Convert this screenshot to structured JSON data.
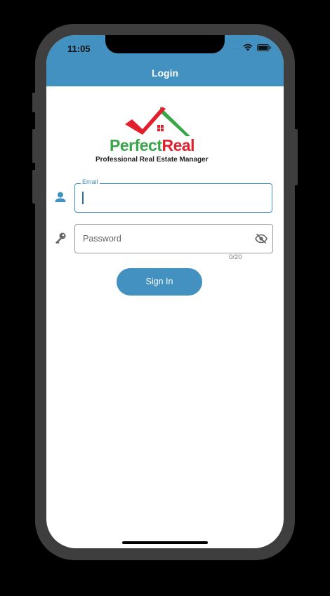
{
  "status_bar": {
    "time": "11:05",
    "signal": "....",
    "icons": [
      "wifi-icon",
      "battery-icon"
    ]
  },
  "nav": {
    "title": "Login",
    "color": "#4391c1"
  },
  "logo": {
    "word_1": "Perfect",
    "word_2": "Real",
    "tagline": "Professional Real Estate Manager",
    "colors": {
      "perfect": "#3aa64a",
      "real": "#e21f2d",
      "roof_check": "#e21f2d",
      "roof": "#3aa64a"
    }
  },
  "form": {
    "email": {
      "label": "Email",
      "value": "",
      "icon": "person-icon"
    },
    "password": {
      "placeholder": "Password",
      "value": "",
      "icon": "key-icon",
      "toggle_icon": "eye-off-icon",
      "counter": "0/20"
    },
    "sign_in_label": "Sign In"
  }
}
